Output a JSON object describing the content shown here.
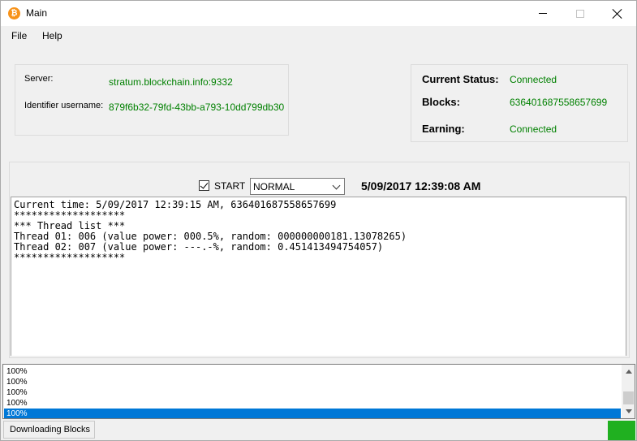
{
  "window": {
    "title": "Main"
  },
  "menu": {
    "file": "File",
    "help": "Help"
  },
  "server": {
    "server_label": "Server:",
    "server_value": "stratum.blockchain.info:9332",
    "identifier_label": "Identifier username:",
    "identifier_value": "879f6b32-79fd-43bb-a793-10dd799db30"
  },
  "status": {
    "current_status_label": "Current Status:",
    "current_status_value": "Connected",
    "blocks_label": "Blocks:",
    "blocks_value": "636401687558657699",
    "earning_label": "Earning:",
    "earning_value": "Connected"
  },
  "controls": {
    "start_label": "START",
    "start_checked": true,
    "mode_value": "NORMAL",
    "datetime": "5/09/2017 12:39:08 AM"
  },
  "console": {
    "lines": [
      "Current time: 5/09/2017 12:39:15 AM, 636401687558657699",
      "*******************",
      "*** Thread list ***",
      "Thread 01: 006 (value power: 000.5%, random: 000000000181.13078265)",
      "Thread 02: 007 (value power: ---.-%, random: 0.451413494754057)",
      "*******************"
    ]
  },
  "progress_list": {
    "items": [
      "100%",
      "100%",
      "100%",
      "100%",
      "100%"
    ],
    "selected_index": 4
  },
  "statusbar": {
    "text": "Downloading Blocks",
    "indicator_color": "#20b020"
  },
  "colors": {
    "accent": "#0078d7",
    "success_text": "#008000"
  },
  "icons": {
    "app": "bitcoin-icon"
  }
}
